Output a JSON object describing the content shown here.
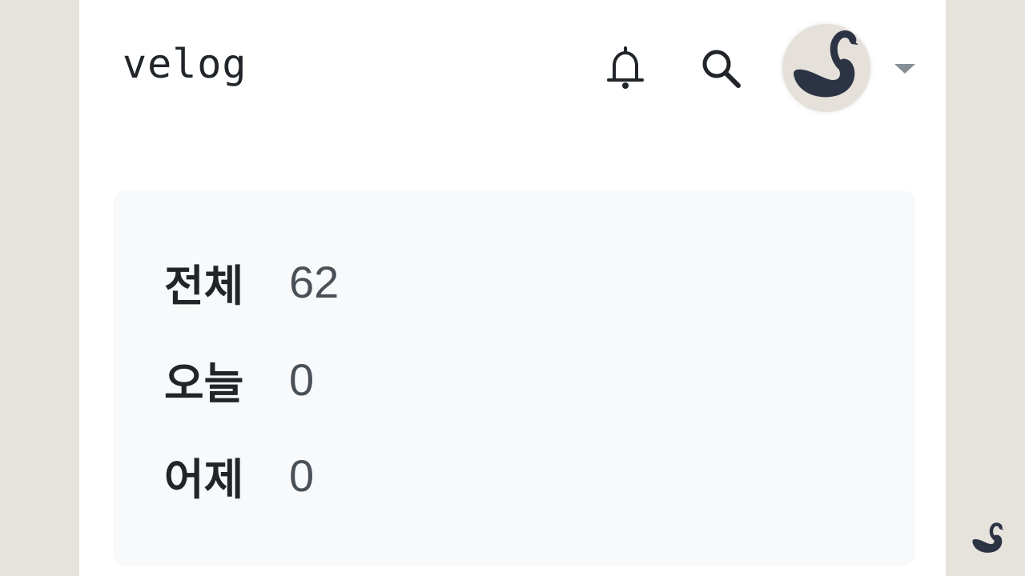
{
  "header": {
    "logo_text": "velog",
    "notification_icon": "bell-icon",
    "search_icon": "search-icon",
    "avatar_icon": "swan-icon",
    "dropdown_icon": "caret-down-icon"
  },
  "stats": {
    "rows": [
      {
        "label": "전체",
        "value": "62"
      },
      {
        "label": "오늘",
        "value": "0"
      },
      {
        "label": "어제",
        "value": "0"
      }
    ]
  },
  "colors": {
    "background": "#e6e2dc",
    "card": "#ffffff",
    "stats_panel": "#f8f9fa",
    "text_primary": "#212529",
    "text_value": "#495057",
    "icon_dark": "#2b3344"
  }
}
